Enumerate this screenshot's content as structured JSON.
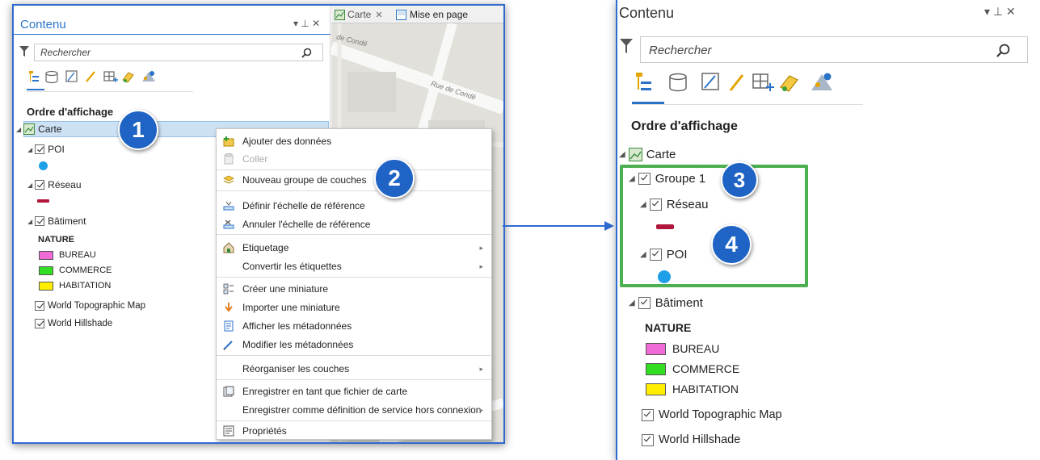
{
  "left": {
    "pane_title": "Contenu",
    "pane_controls": "▾ ⊥ ✕",
    "search_placeholder": "Rechercher",
    "section_title": "Ordre d'affichage",
    "tabs": {
      "map": "Carte",
      "layout": "Mise en page"
    },
    "street_labels": [
      "de Condé",
      "Rue de Condé"
    ],
    "layers": {
      "map": "Carte",
      "poi": "POI",
      "reseau": "Réseau",
      "batiment": "Bâtiment",
      "nature_heading": "NATURE",
      "bureau": "BUREAU",
      "commerce": "COMMERCE",
      "habitation": "HABITATION",
      "topo": "World Topographic Map",
      "hillshade": "World Hillshade"
    }
  },
  "context_menu": {
    "items": [
      {
        "label": "Ajouter des données",
        "icon": "add-data-icon"
      },
      {
        "label": "Coller",
        "icon": "paste-icon",
        "disabled": true
      },
      {
        "label": "Nouveau groupe de couches",
        "icon": "group-layer-icon"
      },
      {
        "label": "Définir l'échelle de référence",
        "icon": "set-scale-icon"
      },
      {
        "label": "Annuler l'échelle de référence",
        "icon": "clear-scale-icon"
      },
      {
        "label": "Etiquetage",
        "icon": "labeling-icon",
        "submenu": true
      },
      {
        "label": "Convertir les étiquettes",
        "submenu": true
      },
      {
        "label": "Créer une miniature",
        "icon": "create-thumbnail-icon"
      },
      {
        "label": "Importer une miniature",
        "icon": "import-thumbnail-icon"
      },
      {
        "label": "Afficher les métadonnées",
        "icon": "view-metadata-icon"
      },
      {
        "label": "Modifier les métadonnées",
        "icon": "edit-metadata-icon"
      },
      {
        "label": "Réorganiser les couches",
        "submenu": true
      },
      {
        "label": "Enregistrer en tant que fichier de carte",
        "icon": "save-map-file-icon"
      },
      {
        "label": "Enregistrer comme définition de service hors connexion",
        "submenu": true
      },
      {
        "label": "Propriétés",
        "icon": "properties-icon"
      }
    ]
  },
  "right": {
    "pane_title": "Contenu",
    "pane_controls": "▾ ⊥ ✕",
    "search_placeholder": "Rechercher",
    "section_title": "Ordre d'affichage",
    "layers": {
      "map": "Carte",
      "group": "Groupe 1",
      "reseau": "Réseau",
      "poi": "POI",
      "batiment": "Bâtiment",
      "nature_heading": "NATURE",
      "bureau": "BUREAU",
      "commerce": "COMMERCE",
      "habitation": "HABITATION",
      "topo": "World Topographic Map",
      "hillshade": "World Hillshade"
    }
  },
  "badges": [
    "1",
    "2",
    "3",
    "4"
  ],
  "colors": {
    "accent": "#2b73c8",
    "badge": "#1f63c4",
    "highlight_box": "#4caf50",
    "poi_symbol": "#1ea0e8",
    "reseau_symbol": "#b0163c",
    "bureau": "#f06bd6",
    "commerce": "#33dd22",
    "habitation": "#ffee00"
  }
}
